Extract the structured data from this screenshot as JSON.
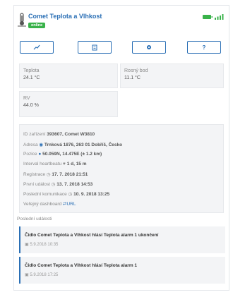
{
  "device": {
    "title": "Comet Teplota a Vlhkost",
    "status": "online"
  },
  "buttons": {
    "chart": "chart-icon",
    "doc": "document-icon",
    "settings": "gear-icon",
    "help": "?"
  },
  "readings": {
    "temp_label": "Teplota",
    "temp_value": "24.1 °C",
    "dew_label": "Rosný bod",
    "dew_value": "11.1 °C",
    "rh_label": "RV",
    "rh_value": "44.0 %"
  },
  "info": {
    "id_label": "ID zařízení",
    "id_value": "393607, Comet W3810",
    "address_label": "Adresa",
    "address_value": "Trnková 1876, 263 01 Dobříš, Česko",
    "position_label": "Pozice",
    "position_value": "50.059N, 14.475E (± 1.2 km)",
    "heartbeat_label": "Interval heartbeatu",
    "heartbeat_value": "1 d, 15 m",
    "registration_label": "Registrace",
    "registration_value": "17. 7. 2018 21:51",
    "first_event_label": "První událost",
    "first_event_value": "13. 7. 2018 14:53",
    "last_comm_label": "Poslední komunikace",
    "last_comm_value": "10. 9. 2018 13:25",
    "dashboard_label": "Veřejný dashboard",
    "dashboard_value": "URL"
  },
  "events": {
    "heading": "Poslední události",
    "items": [
      {
        "title": "Čidlo Comet Teplota a Vlhkost hlásí Teplota alarm 1 ukončení",
        "date": "5.9.2018 10:35"
      },
      {
        "title": "Čidlo Comet Teplota a Vlhkost hlásí Teplota alarm 1",
        "date": "5.9.2018 17:25"
      }
    ]
  },
  "colors": {
    "accent": "#2a6fb5",
    "online": "#39b24a",
    "card_bg": "#f3f4f6"
  }
}
